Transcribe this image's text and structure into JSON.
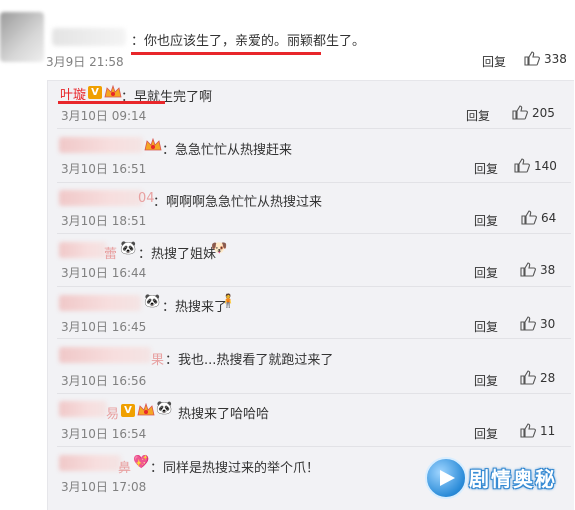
{
  "top_comment": {
    "text": "：你也应该生了，亲爱的。丽颖都生了。",
    "time": "3月9日 21:58",
    "reply_label": "回复",
    "likes": "338"
  },
  "replies": [
    {
      "name": "叶璇",
      "text": "：早就生完了啊",
      "time": "3月10日 09:14",
      "reply_label": "回复",
      "likes": "205"
    },
    {
      "name_fragment": "",
      "text": "：急急忙忙从热搜赶来",
      "time": "3月10日 16:51",
      "reply_label": "回复",
      "likes": "140"
    },
    {
      "name_fragment": "04",
      "text": "：啊啊啊急急忙忙从热搜过来",
      "time": "3月10日 18:51",
      "reply_label": "回复",
      "likes": "64"
    },
    {
      "name_fragment": "蕾",
      "text": "：热搜了姐妹",
      "time": "3月10日 16:44",
      "reply_label": "回复",
      "likes": "38"
    },
    {
      "name_fragment": "",
      "text": "：热搜来了",
      "time": "3月10日 16:45",
      "reply_label": "回复",
      "likes": "30"
    },
    {
      "name_fragment": "果",
      "text": "：我也...热搜看了就跑过来了",
      "time": "3月10日 16:56",
      "reply_label": "回复",
      "likes": "28"
    },
    {
      "name_fragment": "易",
      "text": "热搜来了哈哈哈",
      "time": "3月10日 16:54",
      "reply_label": "回复",
      "likes": "11"
    },
    {
      "name_fragment": "鼻",
      "text": "：同样是热搜过来的举个爪！",
      "time": "3月10日 17:08",
      "reply_label": "",
      "likes": ""
    }
  ],
  "watermark": {
    "text": "剧情奥秘"
  },
  "colors": {
    "accent_red": "#e8262a",
    "panel_bg": "#f2f2f5",
    "time_gray": "#808080"
  }
}
